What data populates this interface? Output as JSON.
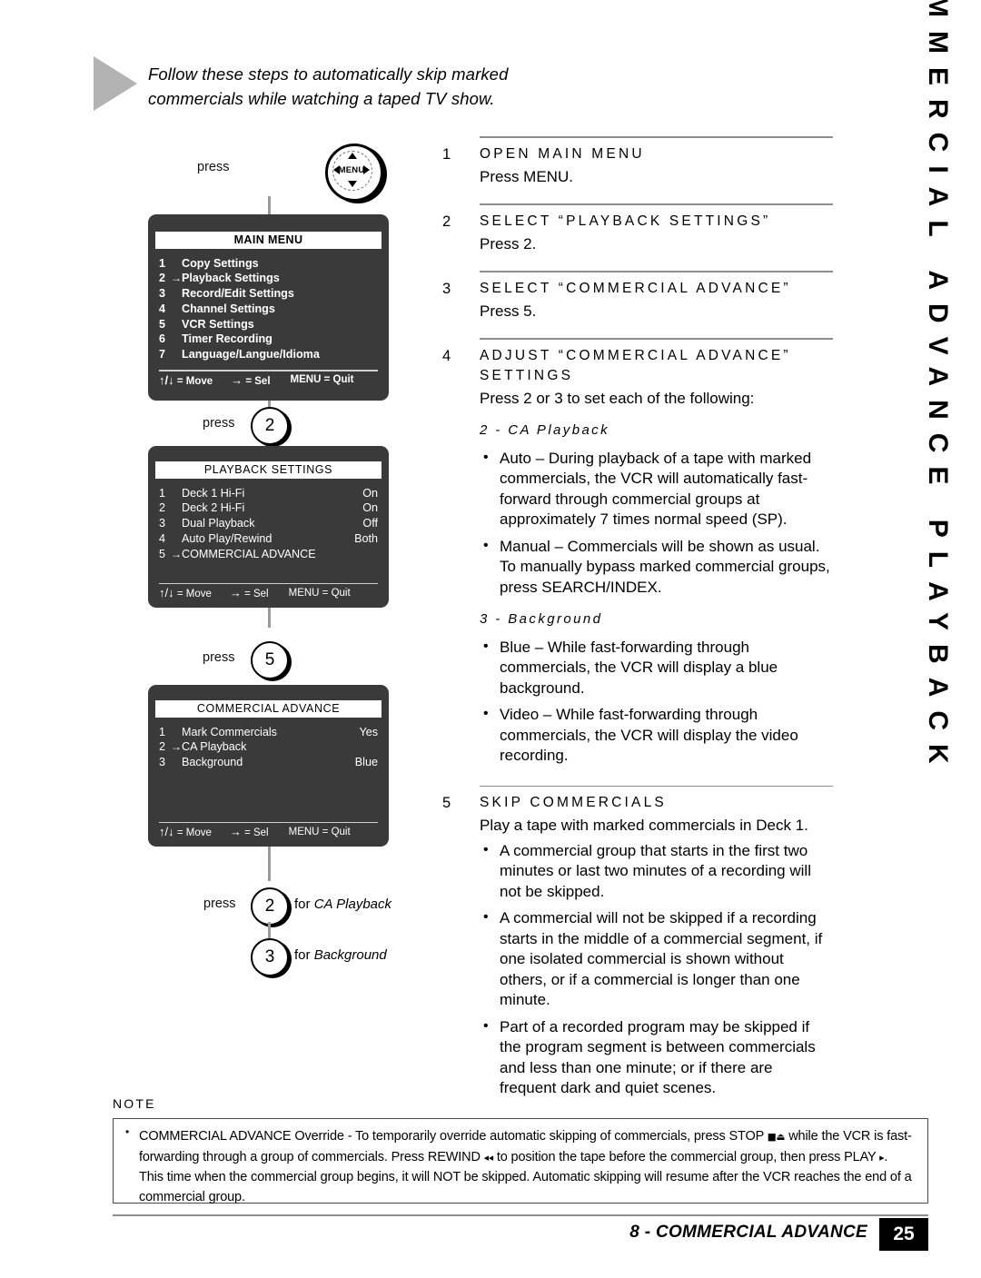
{
  "intro": {
    "text": "Follow these steps to automatically skip marked commercials while watching a taped TV show."
  },
  "side_tab": {
    "title": "COMMERCIAL ADVANCE PLAYBACK"
  },
  "diagram": {
    "press_label": "press",
    "menu_button_label": "MENU",
    "step_keys": {
      "key2": "2",
      "key5": "5",
      "key2b": "2",
      "key3": "3"
    },
    "for_ca_playback": "for ",
    "for_ca_playback_italic": "CA Playback",
    "for_background": "for ",
    "for_background_italic": "Background",
    "footer": {
      "move": "= Move",
      "sel": "= Sel",
      "quit": "MENU = Quit",
      "updown": "↑/↓",
      "rightarrow": "→"
    },
    "screens": [
      {
        "title": "MAIN MENU",
        "rows": [
          {
            "num": "1",
            "arrow": "",
            "label": "Copy Settings",
            "value": ""
          },
          {
            "num": "2",
            "arrow": "→",
            "label": "Playback Settings",
            "value": ""
          },
          {
            "num": "3",
            "arrow": "",
            "label": "Record/Edit Settings",
            "value": ""
          },
          {
            "num": "4",
            "arrow": "",
            "label": "Channel Settings",
            "value": ""
          },
          {
            "num": "5",
            "arrow": "",
            "label": "VCR Settings",
            "value": ""
          },
          {
            "num": "6",
            "arrow": "",
            "label": "Timer Recording",
            "value": ""
          },
          {
            "num": "7",
            "arrow": "",
            "label": "Language/Langue/Idioma",
            "value": ""
          }
        ]
      },
      {
        "title": "PLAYBACK SETTINGS",
        "rows": [
          {
            "num": "1",
            "arrow": "",
            "label": "Deck 1 Hi-Fi",
            "value": "On"
          },
          {
            "num": "2",
            "arrow": "",
            "label": "Deck 2 Hi-Fi",
            "value": "On"
          },
          {
            "num": "3",
            "arrow": "",
            "label": "Dual Playback",
            "value": "Off"
          },
          {
            "num": "4",
            "arrow": "",
            "label": "Auto Play/Rewind",
            "value": "Both"
          },
          {
            "num": "5",
            "arrow": "→",
            "label": "COMMERCIAL ADVANCE",
            "value": ""
          }
        ]
      },
      {
        "title": "COMMERCIAL ADVANCE",
        "rows": [
          {
            "num": "1",
            "arrow": "",
            "label": "Mark Commercials",
            "value": "Yes"
          },
          {
            "num": "2",
            "arrow": "→",
            "label": "CA Playback",
            "value": ""
          },
          {
            "num": "3",
            "arrow": "",
            "label": "Background",
            "value": "Blue"
          }
        ]
      }
    ]
  },
  "steps": [
    {
      "num": "1",
      "title": "OPEN MAIN MENU",
      "body": [
        "Press MENU."
      ]
    },
    {
      "num": "2",
      "title": "SELECT “PLAYBACK SETTINGS”",
      "body": [
        "Press 2."
      ]
    },
    {
      "num": "3",
      "title": "SELECT “COMMERCIAL ADVANCE”",
      "body": [
        "Press 5."
      ]
    },
    {
      "num": "4",
      "title": "ADJUST “COMMERCIAL ADVANCE” SETTINGS",
      "body": [
        "Press 2 or 3 to set each of the following:"
      ],
      "subsections": [
        {
          "heading": "2 - CA Playback",
          "bullets": [
            "Auto – During playback of a tape with marked commercials, the VCR will automatically fast-forward through commercial groups at approximately 7 times normal speed (SP).",
            "Manual – Commercials will be shown as usual. To manually bypass marked commercial groups, press SEARCH/INDEX."
          ]
        },
        {
          "heading": "3 - Background",
          "bullets": [
            "Blue – While fast-forwarding through commercials, the VCR will display a blue background.",
            "Video – While fast-forwarding through commercials, the VCR will display the video recording."
          ]
        }
      ]
    },
    {
      "num": "5",
      "title": "SKIP COMMERCIALS",
      "body": [
        "Play a tape with marked commercials in Deck 1."
      ],
      "bullets": [
        "A commercial group that starts in the first two minutes or last two minutes of a recording will not be skipped.",
        "A commercial will not be skipped if a recording starts in the middle of a commercial segment, if one isolated commercial is shown without others, or if a commercial is longer than one minute.",
        "Part of a recorded program may be skipped if the program segment is between commercials and less than one minute; or if there are frequent dark and quiet scenes."
      ]
    }
  ],
  "note": {
    "label": "NOTE",
    "text_part1": "COMMERCIAL ADVANCE Override - To temporarily override automatic skipping of commercials, press STOP ",
    "stop_symbol": "■⏏",
    "text_part2": " while the VCR is fast-forwarding through a group of commercials. Press REWIND ",
    "rewind_symbol": "◂◂",
    "text_part3": " to position the tape before the commercial group, then press PLAY ",
    "play_symbol": "▸",
    "text_part4": ". This time when the commercial group begins, it will NOT be skipped. Automatic skipping will resume after the VCR reaches the end of a commercial group."
  },
  "footer": {
    "title": "8 - COMMERCIAL ADVANCE",
    "page": "25"
  }
}
